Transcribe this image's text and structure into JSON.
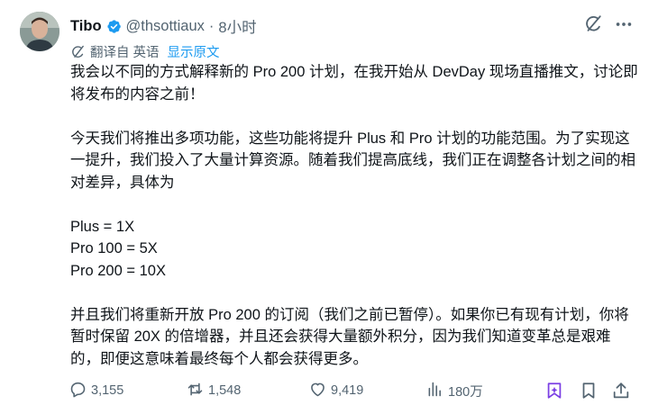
{
  "author": {
    "name": "Tibo",
    "handle": "@thsottiaux",
    "separator": "·",
    "time": "8小时"
  },
  "translation": {
    "label": "翻译自 英语",
    "show_original": "显示原文"
  },
  "body": {
    "paragraph1": "我会以不同的方式解释新的 Pro 200 计划，在我开始从 DevDay 现场直播推文，讨论即将发布的内容之前！",
    "paragraph2": "今天我们将推出多项功能，这些功能将提升 Plus 和 Pro 计划的功能范围。为了实现这一提升，我们投入了大量计算资源。随着我们提高底线，我们正在调整各计划之间的相对差异，具体为",
    "list": [
      "Plus = 1X",
      "Pro 100 = 5X",
      "Pro 200 = 10X"
    ],
    "paragraph3": "并且我们将重新开放 Pro 200 的订阅（我们之前已暂停）。如果你已有现有计划，你将暂时保留 20X 的倍增器，并且还会获得大量额外积分，因为我们知道变革总是艰难的，即便这意味着最终每个人都会获得更多。"
  },
  "actions": {
    "replies": "3,155",
    "reposts": "1,548",
    "likes": "9,419",
    "views": "180万"
  },
  "icons": {
    "verified": "verified-badge-icon",
    "grok": "grok-icon",
    "more": "more-icon",
    "translate": "translate-icon",
    "reply": "reply-icon",
    "repost": "repost-icon",
    "like": "heart-icon",
    "views": "views-icon",
    "grok_action": "grok-action-icon",
    "bookmark": "bookmark-icon",
    "share": "share-icon"
  },
  "colors": {
    "link": "#1d9bf0",
    "verified": "#1d9bf0",
    "secondary_text": "#536471",
    "primary_text": "#0f1419",
    "grok_action": "#7b3fe4"
  }
}
